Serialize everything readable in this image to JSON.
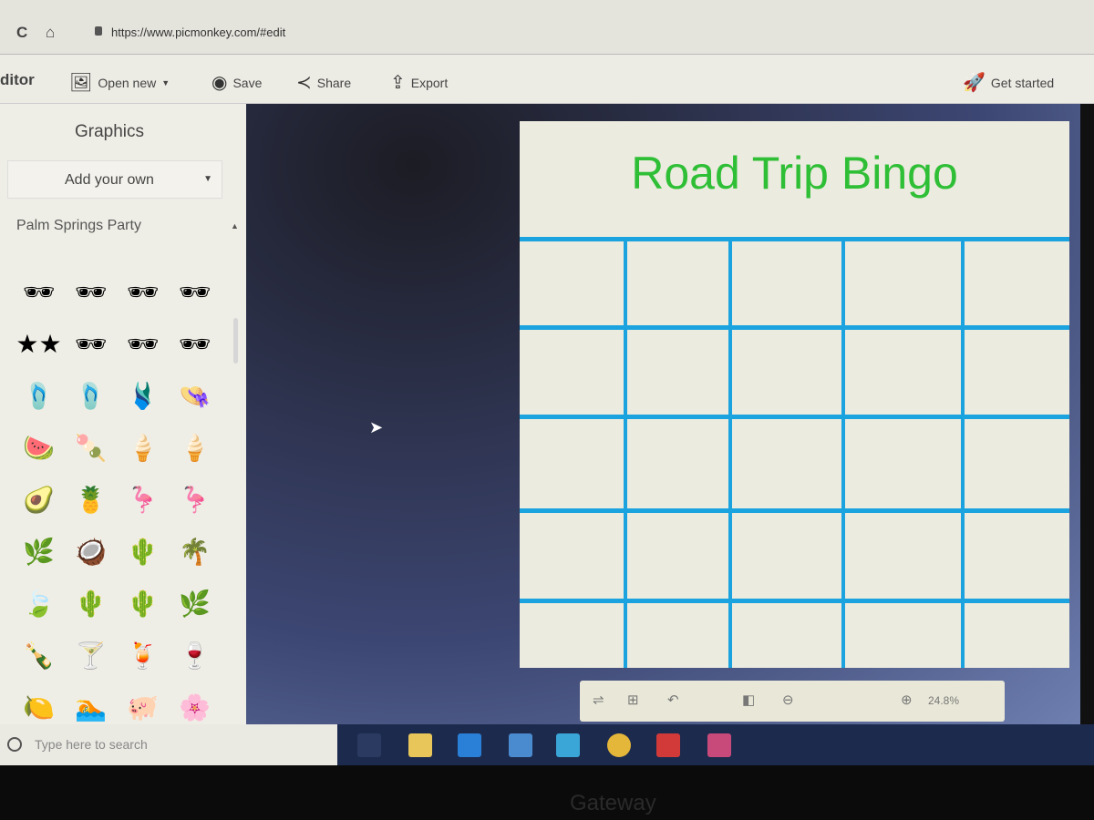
{
  "browser": {
    "url": "https://www.picmonkey.com/#edit"
  },
  "toolbar": {
    "app": "ditor",
    "open_new": "Open new",
    "save": "Save",
    "share": "Share",
    "export": "Export",
    "get_started": "Get started"
  },
  "sidebar": {
    "title": "Graphics",
    "add_own": "Add your own",
    "pack": "Palm Springs Party",
    "graphics": [
      "🕶",
      "🕶",
      "🕶",
      "🕶",
      "★★",
      "🕶",
      "🕶",
      "🕶",
      "🩴",
      "🩴",
      "🩱",
      "👒",
      "🍉",
      "🍡",
      "🍦",
      "🍦",
      "🥑",
      "🍍",
      "🦩",
      "🦩",
      "🌿",
      "🥥",
      "🌵",
      "🌴",
      "🍃",
      "🌵",
      "🌵",
      "🌿",
      "🍾",
      "🍸",
      "🍹",
      "🍷",
      "🍋",
      "🏊",
      "🐖",
      "🌸"
    ]
  },
  "canvas": {
    "design_title": "Road Trip Bingo",
    "title_color": "#2fbf36",
    "grid_color": "#1ba3df",
    "rows": 5,
    "cols": 5
  },
  "zoom": {
    "value": "24.8%"
  },
  "taskbar": {
    "search_placeholder": "Type here to search"
  },
  "bezel": {
    "brand": "Gateway"
  }
}
